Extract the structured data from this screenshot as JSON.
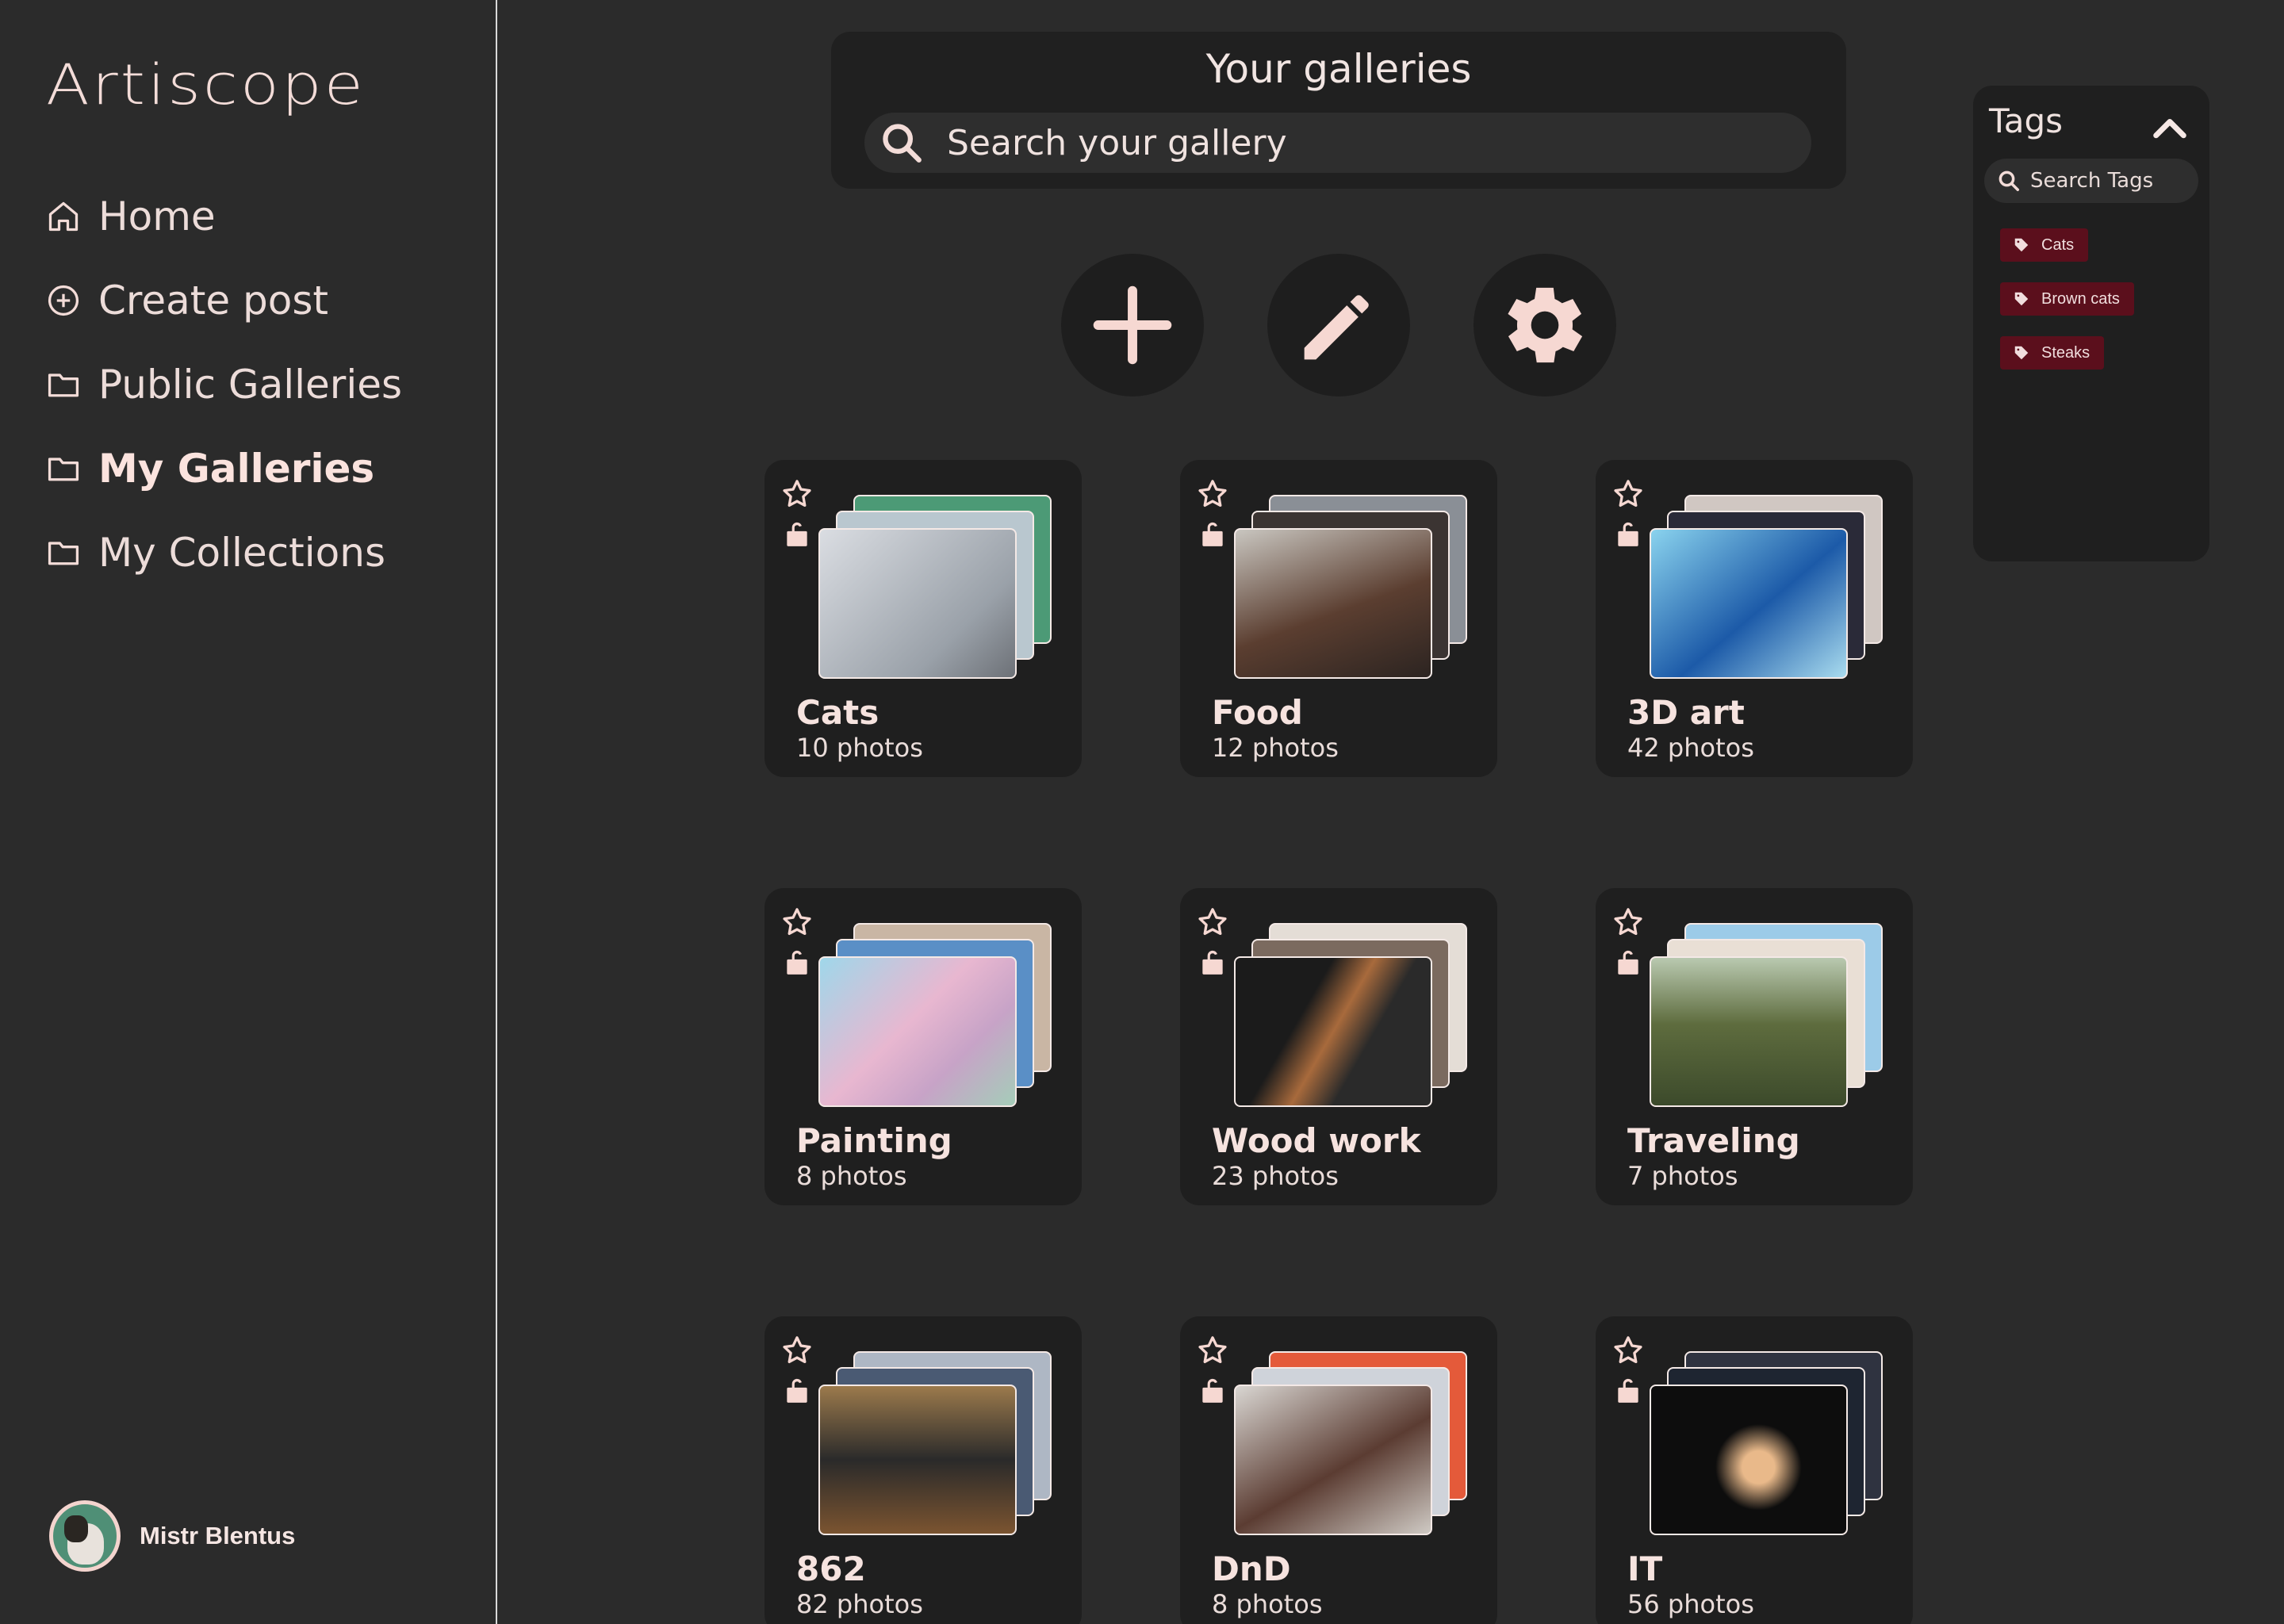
{
  "app": {
    "name": "Artiscope"
  },
  "sidebar": {
    "items": [
      {
        "label": "Home",
        "icon": "home-icon"
      },
      {
        "label": "Create post",
        "icon": "plus-circle-icon"
      },
      {
        "label": "Public Galleries",
        "icon": "folder-icon"
      },
      {
        "label": "My Galleries",
        "icon": "folder-icon",
        "active": true
      },
      {
        "label": "My Collections",
        "icon": "folder-icon"
      }
    ],
    "user": {
      "name": "Mistr Blentus"
    }
  },
  "search": {
    "title": "Your galleries",
    "placeholder": "Search your gallery"
  },
  "actions": [
    {
      "name": "add",
      "icon": "plus-icon"
    },
    {
      "name": "edit",
      "icon": "pencil-icon"
    },
    {
      "name": "settings",
      "icon": "gear-icon"
    }
  ],
  "galleries": [
    {
      "title": "Cats",
      "count": "10 photos"
    },
    {
      "title": "Food",
      "count": "12 photos"
    },
    {
      "title": "3D art",
      "count": "42 photos"
    },
    {
      "title": "Painting",
      "count": "8 photos"
    },
    {
      "title": "Wood work",
      "count": "23 photos"
    },
    {
      "title": "Traveling",
      "count": "7 photos"
    },
    {
      "title": "862",
      "count": "82 photos"
    },
    {
      "title": "DnD",
      "count": "8 photos"
    },
    {
      "title": "IT",
      "count": "56 photos"
    }
  ],
  "tags": {
    "title": "Tags",
    "search_placeholder": "Search Tags",
    "items": [
      "Cats",
      "Brown cats",
      "Steaks"
    ]
  },
  "colors": {
    "background": "#2b2b2b",
    "panel": "#1f1f1f",
    "accent_text": "#f3dcd8",
    "tag_bg": "#5b0f1c"
  }
}
